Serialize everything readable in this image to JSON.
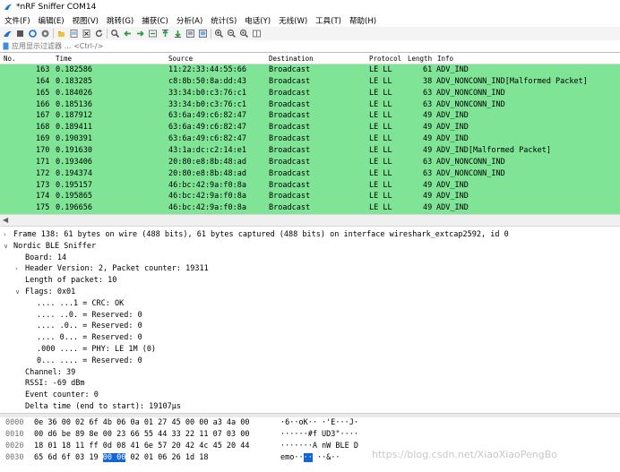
{
  "window": {
    "title": "*nRF Sniffer COM14"
  },
  "menu": {
    "items": [
      "文件(F)",
      "编辑(E)",
      "视图(V)",
      "跳转(G)",
      "捕获(C)",
      "分析(A)",
      "统计(S)",
      "电话(Y)",
      "无线(W)",
      "工具(T)",
      "帮助(H)"
    ]
  },
  "toolbar": {
    "icons": [
      "shark-fin-start-icon",
      "stop-icon",
      "restart-icon",
      "options-gear-icon",
      "open-folder-icon",
      "file-table-icon",
      "close-file-icon",
      "reload-icon",
      "find-icon",
      "go-back-icon",
      "go-forward-icon",
      "go-to-packet-icon",
      "first-packet-icon",
      "last-packet-icon",
      "autoscroll-icon",
      "colorize-icon",
      "zoom-in-icon",
      "zoom-out-icon",
      "zoom-normal-icon",
      "resize-columns-icon"
    ]
  },
  "filter": {
    "placeholder": "应用显示过滤器 … <Ctrl-/>"
  },
  "packet_list": {
    "columns": [
      "No.",
      "Time",
      "Source",
      "Destination",
      "Protocol",
      "Length",
      "Info"
    ],
    "row_color": "#7fe496",
    "rows": [
      {
        "no": "163",
        "time": "0.182586",
        "src": "11:22:33:44:55:66",
        "dst": "Broadcast",
        "proto": "LE LL",
        "len": "61",
        "info": "ADV_IND"
      },
      {
        "no": "164",
        "time": "0.183285",
        "src": "c8:8b:50:8a:dd:43",
        "dst": "Broadcast",
        "proto": "LE LL",
        "len": "38",
        "info": "ADV_NONCONN_IND[Malformed Packet]"
      },
      {
        "no": "165",
        "time": "0.184026",
        "src": "33:34:b0:c3:76:c1",
        "dst": "Broadcast",
        "proto": "LE LL",
        "len": "63",
        "info": "ADV_NONCONN_IND"
      },
      {
        "no": "166",
        "time": "0.185136",
        "src": "33:34:b0:c3:76:c1",
        "dst": "Broadcast",
        "proto": "LE LL",
        "len": "63",
        "info": "ADV_NONCONN_IND"
      },
      {
        "no": "167",
        "time": "0.187912",
        "src": "63:6a:49:c6:82:47",
        "dst": "Broadcast",
        "proto": "LE LL",
        "len": "49",
        "info": "ADV_IND"
      },
      {
        "no": "168",
        "time": "0.189411",
        "src": "63:6a:49:c6:82:47",
        "dst": "Broadcast",
        "proto": "LE LL",
        "len": "49",
        "info": "ADV_IND"
      },
      {
        "no": "169",
        "time": "0.190391",
        "src": "63:6a:49:c6:82:47",
        "dst": "Broadcast",
        "proto": "LE LL",
        "len": "49",
        "info": "ADV_IND"
      },
      {
        "no": "170",
        "time": "0.191630",
        "src": "43:1a:dc:c2:14:e1",
        "dst": "Broadcast",
        "proto": "LE LL",
        "len": "49",
        "info": "ADV_IND[Malformed Packet]"
      },
      {
        "no": "171",
        "time": "0.193406",
        "src": "20:80:e8:8b:48:ad",
        "dst": "Broadcast",
        "proto": "LE LL",
        "len": "63",
        "info": "ADV_NONCONN_IND"
      },
      {
        "no": "172",
        "time": "0.194374",
        "src": "20:80:e8:8b:48:ad",
        "dst": "Broadcast",
        "proto": "LE LL",
        "len": "63",
        "info": "ADV_NONCONN_IND"
      },
      {
        "no": "173",
        "time": "0.195157",
        "src": "46:bc:42:9a:f0:8a",
        "dst": "Broadcast",
        "proto": "LE LL",
        "len": "49",
        "info": "ADV_IND"
      },
      {
        "no": "174",
        "time": "0.195865",
        "src": "46:bc:42:9a:f0:8a",
        "dst": "Broadcast",
        "proto": "LE LL",
        "len": "49",
        "info": "ADV_IND"
      },
      {
        "no": "175",
        "time": "0.196656",
        "src": "46:bc:42:9a:f0:8a",
        "dst": "Broadcast",
        "proto": "LE LL",
        "len": "49",
        "info": "ADV_IND"
      }
    ]
  },
  "details": [
    {
      "indent": 0,
      "tw": ">",
      "text": "Frame 138: 61 bytes on wire (488 bits), 61 bytes captured (488 bits) on interface wireshark_extcap2592, id 0"
    },
    {
      "indent": 0,
      "tw": "v",
      "text": "Nordic BLE Sniffer"
    },
    {
      "indent": 1,
      "tw": "",
      "text": "Board: 14"
    },
    {
      "indent": 1,
      "tw": ">",
      "text": "Header Version: 2, Packet counter: 19311"
    },
    {
      "indent": 1,
      "tw": "",
      "text": "Length of packet: 10"
    },
    {
      "indent": 1,
      "tw": "v",
      "text": "Flags: 0x01"
    },
    {
      "indent": 2,
      "tw": "",
      "text": ".... ...1 = CRC: OK"
    },
    {
      "indent": 2,
      "tw": "",
      "text": ".... ..0. = Reserved: 0"
    },
    {
      "indent": 2,
      "tw": "",
      "text": ".... .0.. = Reserved: 0"
    },
    {
      "indent": 2,
      "tw": "",
      "text": ".... 0... = Reserved: 0"
    },
    {
      "indent": 2,
      "tw": "",
      "text": ".000 .... = PHY: LE 1M (0)"
    },
    {
      "indent": 2,
      "tw": "",
      "text": "0... .... = Reserved: 0"
    },
    {
      "indent": 1,
      "tw": "",
      "text": "Channel: 39"
    },
    {
      "indent": 1,
      "tw": "",
      "text": "RSSI: -69 dBm"
    },
    {
      "indent": 1,
      "tw": "",
      "text": "Event counter: 0"
    },
    {
      "indent": 1,
      "tw": "",
      "text": "Delta time (end to start): 19107µs"
    }
  ],
  "bytes": [
    {
      "offset": "0000",
      "hex_pre": "0e 36 00 02 6f 4b 06 0a  01 27 45 00 00 a3 4a 00",
      "hex_hl": "",
      "hex_post": "",
      "ascii_pre": "·6··oK·· ·'E···J·",
      "ascii_hl": "",
      "ascii_post": ""
    },
    {
      "offset": "0010",
      "hex_pre": "00 d6 be 89 8e 00 23 66  55 44 33 22 11 07 03 00",
      "hex_hl": "",
      "hex_post": "",
      "ascii_pre": "······#f UD3\"····",
      "ascii_hl": "",
      "ascii_post": ""
    },
    {
      "offset": "0020",
      "hex_pre": "18 01 18 11 ff 0d 08 41  6e 57 20 42 4c 45 20 44",
      "hex_hl": "",
      "hex_post": "",
      "ascii_pre": "·······A nW BLE D",
      "ascii_hl": "",
      "ascii_post": ""
    },
    {
      "offset": "0030",
      "hex_pre": "65 6d 6f 03 19 ",
      "hex_hl": "00 00",
      "hex_post": " 02  01 06 26 1d 18",
      "ascii_pre": "emo··",
      "ascii_hl": "··",
      "ascii_post": " ··&··"
    }
  ],
  "watermark": "https://blog.csdn.net/XiaoXiaoPengBo"
}
